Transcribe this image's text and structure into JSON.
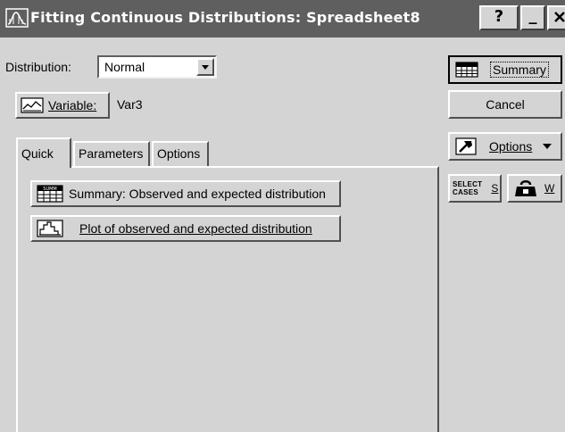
{
  "window": {
    "title": "Fitting Continuous Distributions: Spreadsheet8",
    "help_label": "?",
    "minimize_label": "_"
  },
  "distribution": {
    "label": "Distribution:",
    "value": "Normal"
  },
  "variable": {
    "button_label": "Variable:",
    "value": "Var3"
  },
  "tabs": [
    {
      "label": "Quick"
    },
    {
      "label": "Parameters"
    },
    {
      "label": "Options"
    }
  ],
  "quick": {
    "summary_label": "Summary:  Observed and expected distribution",
    "plot_label": "Plot of observed and expected distribution"
  },
  "side": {
    "summary_label": "Summary",
    "cancel_label": "Cancel",
    "options_label": "Options",
    "select_cases_line1": "SELECT",
    "select_cases_line2": "CASES",
    "select_cases_key": "S",
    "weight_key": "W"
  },
  "colors": {
    "titlebar": "#5f5f5f",
    "face": "#d4d4d4"
  }
}
